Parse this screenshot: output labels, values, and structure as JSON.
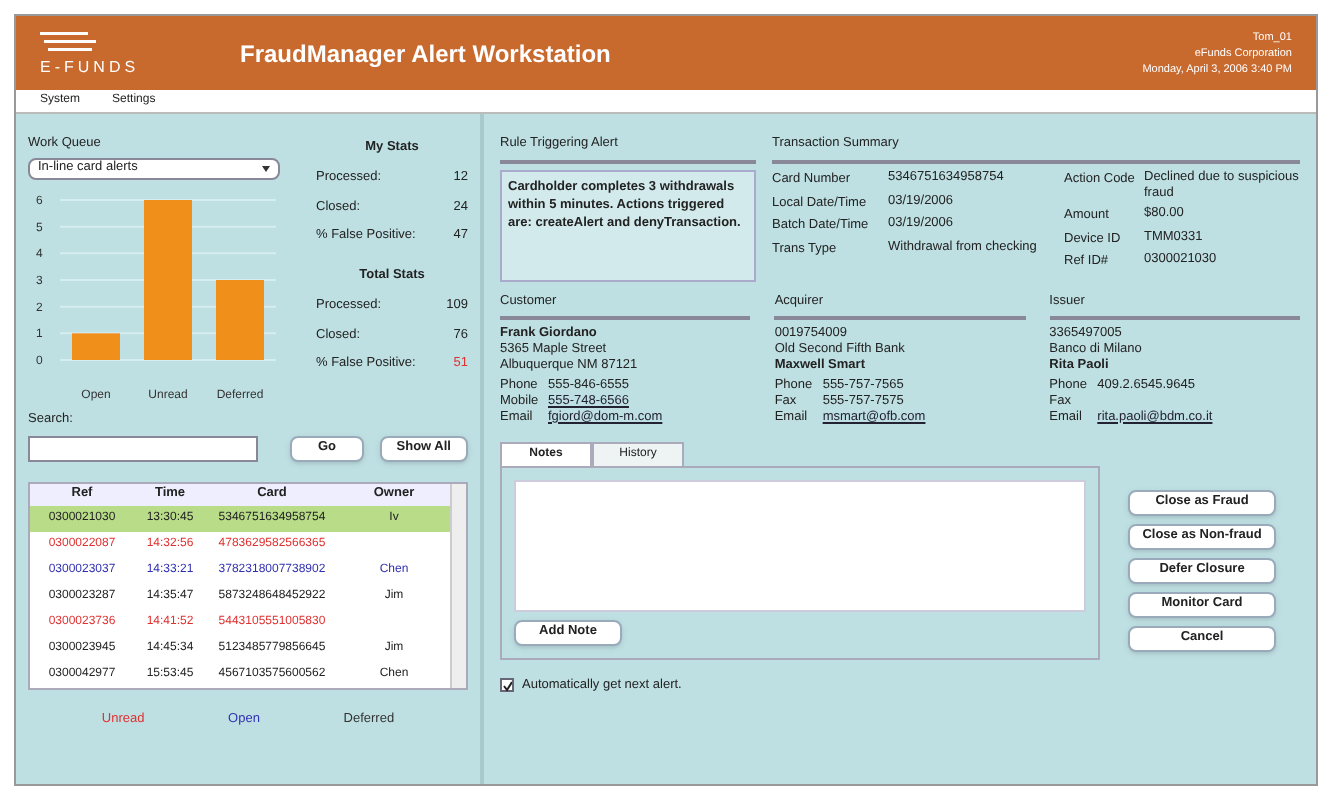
{
  "header": {
    "logo_text": "E-FUNDS",
    "title": "FraudManager Alert Workstation",
    "user": "Tom_01",
    "company": "eFunds Corporation",
    "datetime": "Monday, April 3, 2006 3:40 PM"
  },
  "menu": [
    {
      "label": "System"
    },
    {
      "label": "Settings"
    }
  ],
  "work_queue": {
    "label": "Work Queue",
    "value": "In-line card alerts",
    "chart_data": {
      "type": "bar",
      "categories": [
        "Open",
        "Unread",
        "Deferred"
      ],
      "values": [
        1,
        6,
        3
      ],
      "yticks": [
        0,
        1,
        2,
        3,
        4,
        5,
        6
      ],
      "ylim": [
        0,
        6
      ],
      "grid": true
    }
  },
  "stats": [
    {
      "title": "My Stats",
      "rows": [
        {
          "label": "Processed:",
          "value": "12",
          "flagged": false
        },
        {
          "label": "Closed:",
          "value": "24",
          "flagged": false
        },
        {
          "label": "% False Positive:",
          "value": "47",
          "flagged": false
        }
      ]
    },
    {
      "title": "Total Stats",
      "rows": [
        {
          "label": "Processed:",
          "value": "109",
          "flagged": false
        },
        {
          "label": "Closed:",
          "value": "76",
          "flagged": false
        },
        {
          "label": "% False Positive:",
          "value": "51",
          "flagged": true
        }
      ]
    }
  ],
  "search": {
    "label": "Search:",
    "go": "Go",
    "show_all": "Show All"
  },
  "table": {
    "columns": [
      "Ref",
      "Time",
      "Card",
      "Owner"
    ],
    "rows": [
      {
        "cells": [
          "0300021030",
          "13:30:45",
          "5346751634958754",
          "Iv"
        ],
        "color": "#222222",
        "selected": true
      },
      {
        "cells": [
          "0300022087",
          "14:32:56",
          "4783629582566365",
          ""
        ],
        "color": "#e03030",
        "selected": false
      },
      {
        "cells": [
          "0300023037",
          "14:33:21",
          "3782318007738902",
          "Chen"
        ],
        "color": "#3030b0",
        "selected": false
      },
      {
        "cells": [
          "0300023287",
          "14:35:47",
          "5873248648452922",
          "Jim"
        ],
        "color": "#222222",
        "selected": false
      },
      {
        "cells": [
          "0300023736",
          "14:41:52",
          "5443105551005830",
          ""
        ],
        "color": "#e03030",
        "selected": false
      },
      {
        "cells": [
          "0300023945",
          "14:45:34",
          "5123485779856645",
          "Jim"
        ],
        "color": "#222222",
        "selected": false
      },
      {
        "cells": [
          "0300042977",
          "15:53:45",
          "4567103575600562",
          "Chen"
        ],
        "color": "#222222",
        "selected": false
      }
    ]
  },
  "legend": [
    {
      "label": "Unread",
      "color": "#e03030"
    },
    {
      "label": "Open",
      "color": "#3030b0"
    },
    {
      "label": "Deferred",
      "color": "#333333"
    }
  ],
  "rule": {
    "title": "Rule Triggering Alert",
    "text": "Cardholder completes 3 withdrawals within 5 minutes. Actions triggered are: createAlert and denyTransaction."
  },
  "summary": {
    "title": "Transaction Summary",
    "left": [
      {
        "label": "Card Number",
        "value": "5346751634958754"
      },
      {
        "label": "Local Date/Time",
        "value": "03/19/2006"
      },
      {
        "label": "Batch Date/Time",
        "value": "03/19/2006"
      },
      {
        "label": "Trans Type",
        "value": "Withdrawal from checking"
      }
    ],
    "right": [
      {
        "label": "Action Code",
        "value": "Declined due to suspicious fraud"
      },
      {
        "label": "Amount",
        "value": "$80.00"
      },
      {
        "label": "Device ID",
        "value": "TMM0331"
      },
      {
        "label": "Ref ID#",
        "value": "0300021030"
      }
    ]
  },
  "parties": [
    {
      "title": "Customer",
      "lines": [
        {
          "text": "Frank Giordano",
          "bold": true
        },
        {
          "text": "5365 Maple Street",
          "bold": false
        },
        {
          "text": "Albuquerque NM 87121",
          "bold": false
        }
      ],
      "contacts": [
        {
          "label": "Phone",
          "value": "555-846-6555",
          "link": false
        },
        {
          "label": "Mobile",
          "value": "555-748-6566",
          "link": true
        },
        {
          "label": "Email",
          "value": "fgiord@dom-m.com",
          "link": true
        }
      ]
    },
    {
      "title": "Acquirer",
      "lines": [
        {
          "text": "0019754009",
          "bold": false
        },
        {
          "text": "Old Second Fifth Bank",
          "bold": false
        },
        {
          "text": "Maxwell Smart",
          "bold": true
        }
      ],
      "contacts": [
        {
          "label": "Phone",
          "value": "555-757-7565",
          "link": false
        },
        {
          "label": "Fax",
          "value": "555-757-7575",
          "link": false
        },
        {
          "label": "Email",
          "value": "msmart@ofb.com",
          "link": true
        }
      ]
    },
    {
      "title": "Issuer",
      "lines": [
        {
          "text": "3365497005",
          "bold": false
        },
        {
          "text": "Banco di Milano",
          "bold": false
        },
        {
          "text": "Rita Paoli",
          "bold": true
        }
      ],
      "contacts": [
        {
          "label": "Phone",
          "value": "409.2.6545.9645",
          "link": false
        },
        {
          "label": "Fax"
        },
        {
          "label": "Email",
          "value": "rita.paoli@bdm.co.it",
          "link": true
        }
      ]
    }
  ],
  "tabs": [
    {
      "label": "Notes",
      "selected": true
    },
    {
      "label": "History",
      "selected": false
    }
  ],
  "add_note": "Add Note",
  "actions": [
    "Close as Fraud",
    "Close as Non-fraud",
    "Defer Closure",
    "Monitor Card",
    "Cancel"
  ],
  "auto_next": {
    "label": "Automatically get next alert.",
    "checked": true
  }
}
